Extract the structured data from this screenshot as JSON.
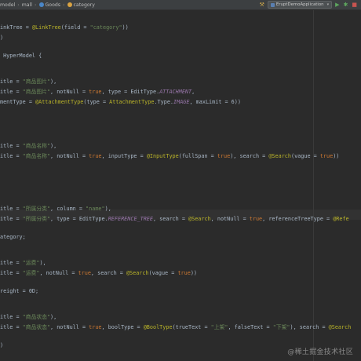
{
  "breadcrumb": {
    "items": [
      {
        "label": "model",
        "icon": "folder-icon"
      },
      {
        "label": "mall",
        "icon": "folder-icon"
      },
      {
        "label": "Goods",
        "icon": "class-icon",
        "color": "#4a86c7"
      },
      {
        "label": "category",
        "icon": "field-icon",
        "color": "#d9a343"
      }
    ]
  },
  "toolbar": {
    "run_config": "EruptDemoApplication",
    "icons": [
      "hammer-icon",
      "run-icon",
      "debug-icon",
      "stop-icon"
    ]
  },
  "watermark": "@稀土掘金技术社区",
  "code": {
    "l01": {
      "t1": "inkTree = ",
      "t2": "@LinkTree",
      "t3": "(field = ",
      "t4": "\"category\"",
      "t5": "))"
    },
    "l02": {
      "t1": ")"
    },
    "l03": {
      "t1": " HyperModel {"
    },
    "l04": {
      "t1": "itle = ",
      "t2": "\"商品图片\"",
      "t3": "),"
    },
    "l05": {
      "t1": "itle = ",
      "t2": "\"商品图片\"",
      "t3": ", notNull = ",
      "t4": "true",
      "t5": ", type = EditType.",
      "t6": "ATTACHMENT",
      "t7": ","
    },
    "l06": {
      "t1": "mentType = ",
      "t2": "@AttachmentType",
      "t3": "(type = ",
      "t4": "AttachmentType",
      "t5": ".Type.",
      "t6": "IMAGE",
      "t7": ", maxLimit = 6))"
    },
    "l07": {
      "t1": "itle = ",
      "t2": "\"商品名称\"",
      "t3": "),"
    },
    "l08": {
      "t1": "itle = ",
      "t2": "\"商品名称\"",
      "t3": ", notNull = ",
      "t4": "true",
      "t5": ", inputType = ",
      "t6": "@InputType",
      "t7": "(fullSpan = ",
      "t8": "true",
      "t9": "), search = ",
      "t10": "@Search",
      "t11": "(vague = ",
      "t12": "true",
      "t13": "))"
    },
    "l09": {
      "t1": "itle = ",
      "t2": "\"所属分类\"",
      "t3": ", column = ",
      "t4": "\"name\"",
      "t5": "),"
    },
    "l10": {
      "t1": "itle = ",
      "t2": "\"所属分类\"",
      "t3": ", type = EditType.",
      "t4": "REFERENCE_TREE",
      "t5": ", search = ",
      "t6": "@Search",
      "t7": ", notNull = ",
      "t8": "true",
      "t9": ", referenceTreeType = ",
      "t10": "@Refe"
    },
    "l11": {
      "t1": "ategory;"
    },
    "l12": {
      "t1": "itle = ",
      "t2": "\"运费\"",
      "t3": "),"
    },
    "l13": {
      "t1": "itle = ",
      "t2": "\"运费\"",
      "t3": ", notNull = ",
      "t4": "true",
      "t5": ", search = ",
      "t6": "@Search",
      "t7": "(vague = ",
      "t8": "true",
      "t9": "))"
    },
    "l14": {
      "t1": "reight = 0D;"
    },
    "l15": {
      "t1": "itle = ",
      "t2": "\"商品状态\"",
      "t3": "),"
    },
    "l16": {
      "t1": "itle = ",
      "t2": "\"商品状态\"",
      "t3": ", notNull = ",
      "t4": "true",
      "t5": ", boolType = ",
      "t6": "@BoolType",
      "t7": "(trueText = ",
      "t8": "\"上架\"",
      "t9": ", falseText = ",
      "t10": "\"下架\"",
      "t11": "), search = ",
      "t12": "@Search"
    },
    "l17": {
      "t1": ")"
    }
  }
}
